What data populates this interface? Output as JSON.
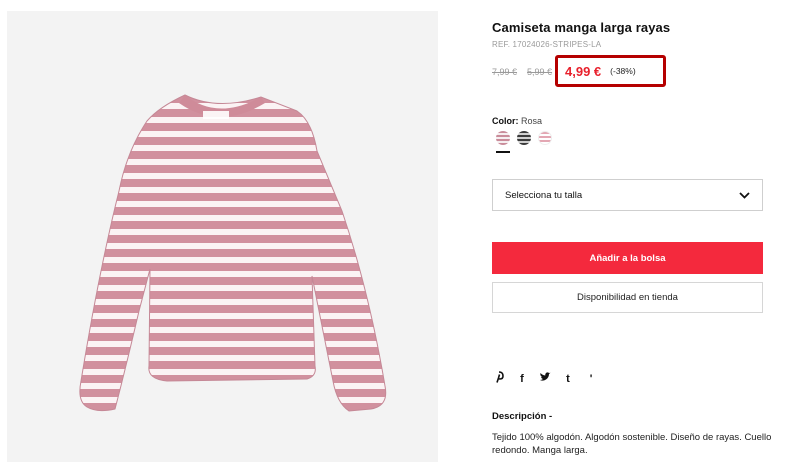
{
  "product": {
    "title": "Camiseta manga larga rayas",
    "ref": "REF. 17024026-STRIPES-LA",
    "image_alt": "Camiseta manga larga rayas rosa"
  },
  "prices": {
    "original": "7,99 €",
    "previous": "5,99 €",
    "current": "4,99 €",
    "discount": "(-38%)",
    "highlight_color": "#b50000",
    "price_color": "#e8202c"
  },
  "color": {
    "label": "Color:",
    "value": "Rosa",
    "swatches": [
      {
        "name": "Rosa",
        "selected": true
      },
      {
        "name": "Negro",
        "selected": false
      },
      {
        "name": "Rosa claro",
        "selected": false
      }
    ]
  },
  "size": {
    "label": "Selecciona tu talla",
    "icon": "chevron-down-icon"
  },
  "buttons": {
    "add_to_bag": "Añadir a la bolsa",
    "add_to_bag_color": "#f4293d",
    "store_availability": "Disponibilidad en tienda"
  },
  "share": {
    "pinterest": "P",
    "facebook": "f",
    "twitter": "🐦",
    "tumblr": "t",
    "more": "'"
  },
  "description": {
    "title": "Descripción -",
    "text": "Tejido 100% algodón. Algodón sostenible. Diseño de rayas. Cuello redondo. Manga larga."
  }
}
